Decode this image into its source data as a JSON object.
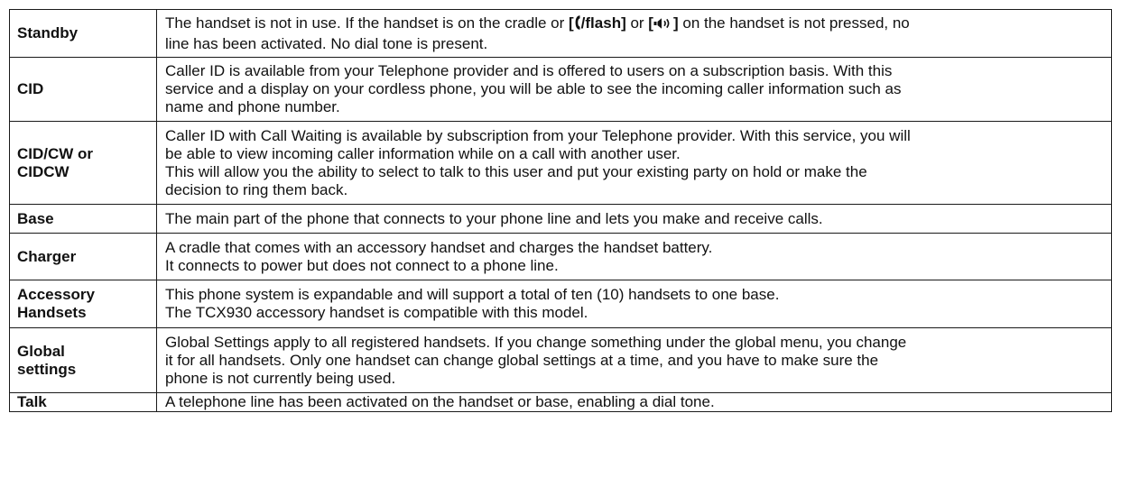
{
  "glossary": {
    "rows": [
      {
        "term": "Standby",
        "lines": [],
        "standby_parts": {
          "pre": "The handset is not in use. If the handset is on the cradle or ",
          "talk_key": "[",
          "talk_key_end": "/flash]",
          "or_text": " or ",
          "speaker_key_open": "[",
          "speaker_key_close": "]",
          "post": " on the handset is not pressed, no",
          "line2": "line has been activated. No dial tone is present."
        },
        "icons": [
          "talk-handset-icon",
          "speaker-icon"
        ]
      },
      {
        "term": "CID",
        "lines": [
          "Caller ID is available from your Telephone provider and is offered to users on a subscription basis. With this",
          "service and a display on your cordless phone, you will be able to see the incoming caller information such as",
          "name and phone number."
        ]
      },
      {
        "term_lines": [
          "CID/CW or",
          "CIDCW"
        ],
        "lines": [
          "Caller ID with Call Waiting is available by subscription from your Telephone provider. With this service, you will",
          "be able to view incoming caller information while on a call with another user.",
          "This will allow you the ability to select to talk to this user and put your existing party on hold or make the",
          "decision to ring them back."
        ]
      },
      {
        "term": "Base",
        "lines": [
          "The main part of the phone that connects to your phone line and lets you make and receive calls."
        ]
      },
      {
        "term": "Charger",
        "lines": [
          "A cradle that comes with an accessory handset and charges the handset battery.",
          "It connects to power but does not connect to a phone line."
        ]
      },
      {
        "term_lines": [
          "Accessory",
          "Handsets"
        ],
        "lines": [
          "This phone system is expandable and will support a total of ten (10) handsets to one base.",
          "The TCX930 accessory handset is compatible with this model."
        ]
      },
      {
        "term_lines": [
          "Global",
          "settings"
        ],
        "lines": [
          "Global Settings apply to all registered handsets. If you change something under the global menu, you change",
          "it for all handsets. Only one handset can change global settings at a time, and you have to make sure the",
          "phone is not currently being used."
        ]
      },
      {
        "term": "Talk",
        "lines": [
          "A telephone line has been activated on the handset or base, enabling a dial tone."
        ]
      }
    ]
  }
}
